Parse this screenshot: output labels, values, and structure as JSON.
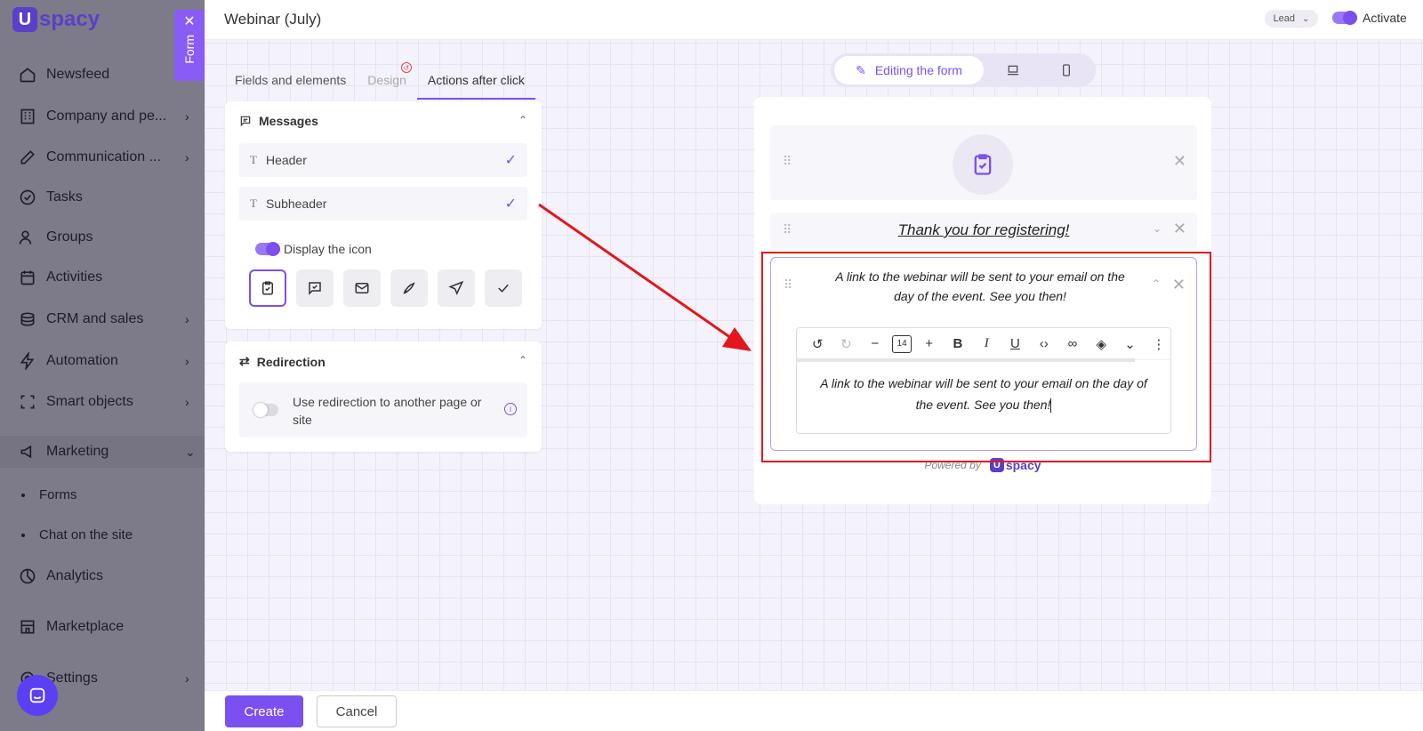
{
  "app": {
    "logo_letter": "U",
    "logo_text": "spacy"
  },
  "sidebar": {
    "items": [
      {
        "label": "Newsfeed",
        "icon": "home-icon",
        "chevron": false
      },
      {
        "label": "Company and pe...",
        "icon": "building-icon",
        "chevron": true
      },
      {
        "label": "Communication ...",
        "icon": "edit-icon",
        "chevron": true
      },
      {
        "label": "Tasks",
        "icon": "check-circle-icon",
        "chevron": false
      },
      {
        "label": "Groups",
        "icon": "users-icon",
        "chevron": false
      },
      {
        "label": "Activities",
        "icon": "calendar-icon",
        "chevron": false
      },
      {
        "label": "CRM and sales",
        "icon": "coins-icon",
        "chevron": true
      },
      {
        "label": "Automation",
        "icon": "lightning-icon",
        "chevron": true
      },
      {
        "label": "Smart objects",
        "icon": "scan-icon",
        "chevron": true
      },
      {
        "label": "Marketing",
        "icon": "megaphone-icon",
        "chevron": true
      },
      {
        "label": "Analytics",
        "icon": "chart-icon",
        "chevron": false
      },
      {
        "label": "Marketplace",
        "icon": "store-icon",
        "chevron": false
      },
      {
        "label": "Settings",
        "icon": "gear-icon",
        "chevron": true
      }
    ],
    "sub_items": [
      "Forms",
      "Chat on the site"
    ]
  },
  "form_tab": {
    "label": "Form"
  },
  "header": {
    "title": "Webinar (July)",
    "entity_select": "Lead",
    "activate_label": "Activate"
  },
  "tabs": [
    "Fields and elements",
    "Design",
    "Actions after click"
  ],
  "messages": {
    "title": "Messages",
    "fields": [
      "Header",
      "Subheader"
    ],
    "display_icon_label": "Display the icon",
    "icons": [
      "clipboard-check-icon",
      "message-check-icon",
      "mail-check-icon",
      "rocket-icon",
      "send-icon",
      "check-icon"
    ]
  },
  "redirection": {
    "title": "Redirection",
    "label": "Use redirection to another page or site"
  },
  "view_modes": {
    "edit_label": "Editing the form"
  },
  "preview": {
    "header_text": "Thank you for registering!",
    "subheader_text": "A link to the webinar will be sent to your email on the day of the event. See you then!",
    "editor_font_size": "14",
    "editor_text": "A link to the webinar will be sent to your email on the day of the event. See you then!",
    "powered_by": "Powered by",
    "powered_logo_letter": "U",
    "powered_logo_text": "spacy"
  },
  "footer": {
    "create_label": "Create",
    "cancel_label": "Cancel"
  },
  "colors": {
    "accent": "#7c4ff0",
    "highlight": "#e3161c",
    "sidebar_bg": "#7d7a8a"
  }
}
